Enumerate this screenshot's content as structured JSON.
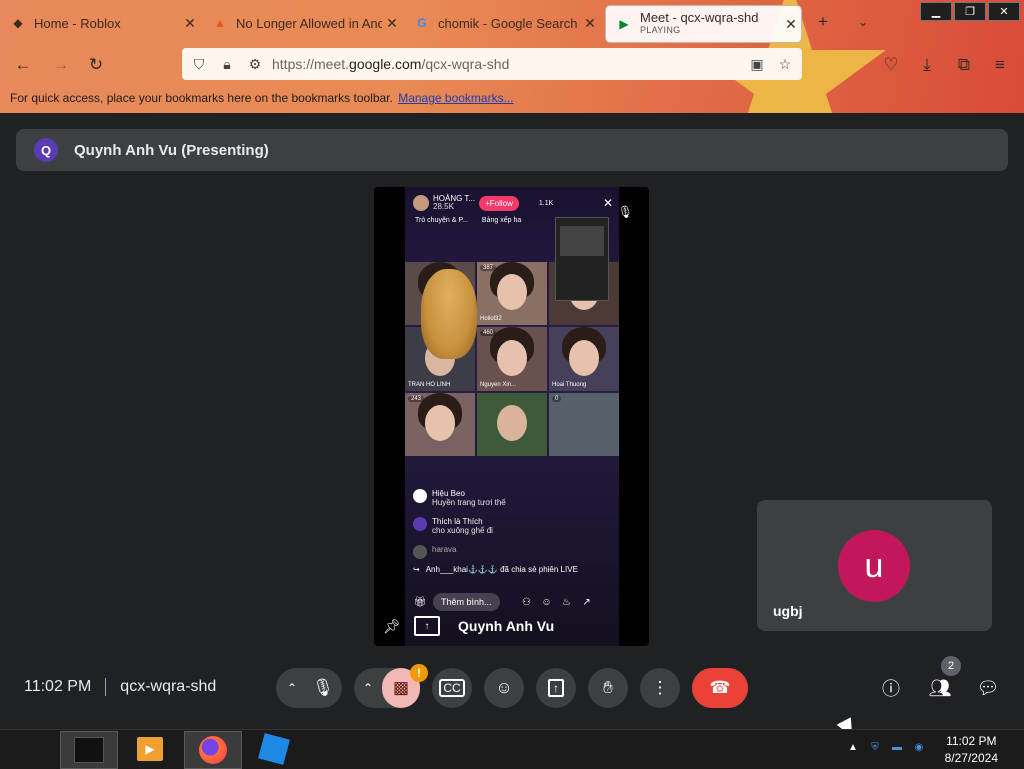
{
  "browser": {
    "tabs": [
      {
        "title": "Home - Roblox",
        "icon": "roblox-icon"
      },
      {
        "title": "No Longer Allowed in And",
        "icon": "flame-icon"
      },
      {
        "title": "chomik - Google Search",
        "icon": "google-icon"
      },
      {
        "title": "Meet - qcx-wqra-shd",
        "subtitle": "PLAYING",
        "icon": "meet-icon",
        "active": true
      }
    ],
    "new_tab": "+",
    "url_prefix": "https://meet.",
    "url_domain": "google.com",
    "url_path": "/qcx-wqra-shd",
    "bookmarks_text": "For quick access, place your bookmarks here on the bookmarks toolbar.",
    "bookmarks_link": "Manage bookmarks..."
  },
  "meet": {
    "presenter_initial": "Q",
    "presenter_title": "Quynh Anh Vu (Presenting)",
    "stage_name": "Quynh Anh Vu",
    "participant_initial": "u",
    "participant_name": "ugbj",
    "time": "11:02 PM",
    "meeting_code": "qcx-wqra-shd",
    "people_count": "2",
    "camera_alert": "!"
  },
  "live": {
    "host_name": "HOÀNG T...",
    "host_likes": "28.5K",
    "follow_label": "+Follow",
    "viewers": "1.1K",
    "tag1": "Trò chuyện & P...",
    "tag2": "Bảng xếp ha",
    "cells": [
      {
        "count": "",
        "label": ""
      },
      {
        "count": "387",
        "label": "Hoilol32"
      },
      {
        "count": "",
        "label": ""
      },
      {
        "count": "",
        "label": "TRAN HO LINH"
      },
      {
        "count": "460",
        "label": "Nguyen Xin..."
      },
      {
        "count": "",
        "label": "Hoai Thuong"
      },
      {
        "count": "243",
        "label": ""
      },
      {
        "count": "",
        "label": ""
      },
      {
        "count": "0",
        "label": ""
      }
    ],
    "chat": [
      {
        "user": "Hiệu Beo",
        "text": "Huyền trang tươi thế"
      },
      {
        "user": "Thích là Thích",
        "text": "cho xuông ghế đi"
      },
      {
        "user": "harava",
        "text": ""
      }
    ],
    "share_text": "Anh___khai⚓⚓⚓ đã chia sẻ phiên LIVE",
    "comment_placeholder": "Thêm bình..."
  },
  "system": {
    "time": "11:02 PM",
    "date": "8/27/2024"
  },
  "colors": {
    "meet_bg": "#202124",
    "end_call_red": "#ea4335",
    "avatar_pink": "#c2185b",
    "presenter_purple": "#5b3bb3"
  }
}
